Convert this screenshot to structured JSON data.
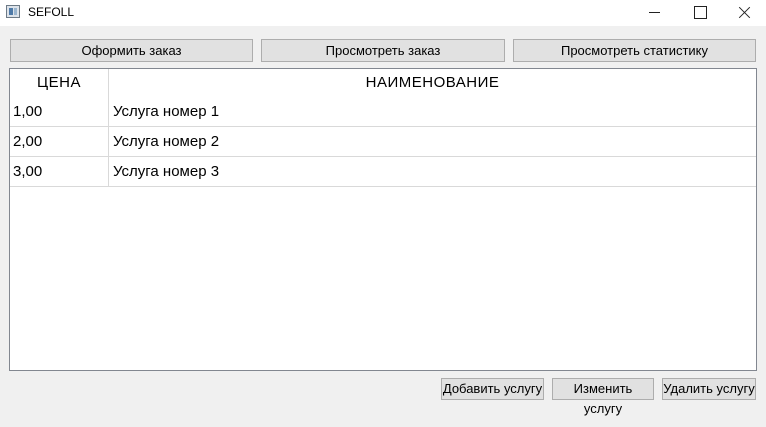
{
  "window": {
    "title": "SEFOLL",
    "icon": "app-window-icon",
    "controls": [
      "minimize-icon",
      "maximize-icon",
      "close-icon"
    ]
  },
  "toolbar": {
    "order_label": "Оформить заказ",
    "view_order_label": "Просмотреть заказ",
    "view_stats_label": "Просмотреть статистику"
  },
  "table": {
    "columns": [
      "ЦЕНА",
      "НАИМЕНОВАНИЕ"
    ],
    "rows": [
      {
        "price": "1,00",
        "name": "Услуга номер 1"
      },
      {
        "price": "2,00",
        "name": "Услуга номер 2"
      },
      {
        "price": "3,00",
        "name": "Услуга номер 3"
      }
    ]
  },
  "actions": {
    "add_label": "Добавить услугу",
    "edit_label": "Изменить услугу",
    "delete_label": "Удалить услугу"
  }
}
